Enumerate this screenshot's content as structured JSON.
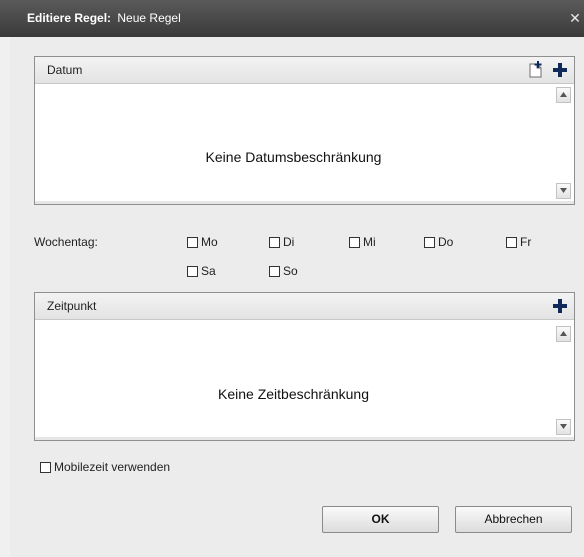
{
  "window": {
    "title_bold": "Editiere Regel:",
    "title_rest": "Neue Regel",
    "close_glyph": "✕"
  },
  "date_panel": {
    "header": "Datum",
    "empty_message": "Keine Datumsbeschränkung",
    "icons": [
      "new-document-icon",
      "plus-icon"
    ]
  },
  "weekday": {
    "label": "Wochentag:",
    "days": [
      {
        "label": "Mo",
        "checked": false
      },
      {
        "label": "Di",
        "checked": false
      },
      {
        "label": "Mi",
        "checked": false
      },
      {
        "label": "Do",
        "checked": false
      },
      {
        "label": "Fr",
        "checked": false
      },
      {
        "label": "Sa",
        "checked": false
      },
      {
        "label": "So",
        "checked": false
      }
    ]
  },
  "time_panel": {
    "header": "Zeitpunkt",
    "empty_message": "Keine Zeitbeschränkung",
    "icons": [
      "plus-icon"
    ]
  },
  "mobile_time": {
    "label": "Mobilezeit verwenden",
    "checked": false
  },
  "buttons": {
    "ok": "OK",
    "cancel": "Abbrechen"
  },
  "colors": {
    "titlebar": "#4a4a4a",
    "plus_icon": "#0f2a5a",
    "dialog_bg": "#ececec"
  }
}
